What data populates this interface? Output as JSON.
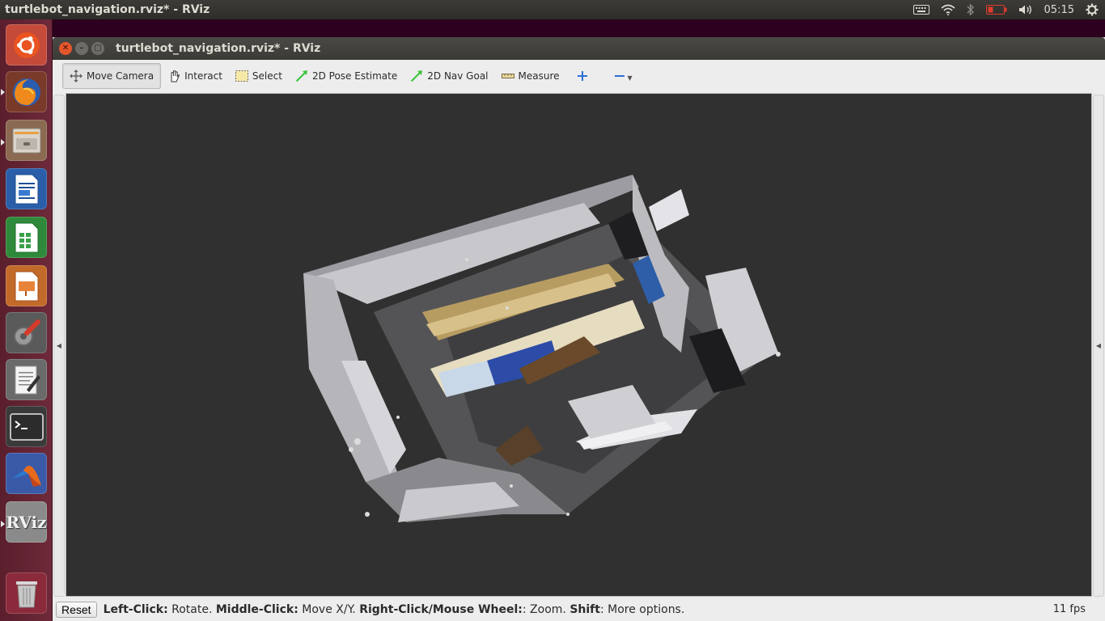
{
  "top_panel": {
    "app_title": "turtlebot_navigation.rviz* - RViz",
    "clock": "05:15",
    "indicators": [
      "keyboard-icon",
      "wifi-icon",
      "bluetooth-icon",
      "battery-icon",
      "volume-icon",
      "settings-gear-icon"
    ]
  },
  "launcher": {
    "items": [
      "ubuntu-dash",
      "firefox",
      "files",
      "libreoffice-writer",
      "libreoffice-calc",
      "libreoffice-impress",
      "system-settings",
      "text-editor",
      "terminal",
      "matlab",
      "rviz",
      "trash"
    ],
    "rviz_label": "RViz"
  },
  "window": {
    "title": "turtlebot_navigation.rviz* - RViz",
    "colors": {
      "viewport_bg": "#303030",
      "accent_green": "#3cc43c",
      "accent_blue": "#2a6fd6"
    }
  },
  "toolbar": {
    "tools": [
      {
        "label": "Move Camera",
        "icon": "move-camera-icon",
        "active": true
      },
      {
        "label": "Interact",
        "icon": "hand-icon",
        "active": false
      },
      {
        "label": "Select",
        "icon": "select-rect-icon",
        "active": false
      },
      {
        "label": "2D Pose Estimate",
        "icon": "green-arrow-icon",
        "active": false
      },
      {
        "label": "2D Nav Goal",
        "icon": "green-arrow-icon",
        "active": false
      },
      {
        "label": "Measure",
        "icon": "ruler-icon",
        "active": false
      }
    ],
    "add_tool_icon": "plus-icon",
    "remove_tool_icon": "minus-icon"
  },
  "status": {
    "reset_label": "Reset",
    "hint_parts": [
      {
        "bold": "Left-Click:",
        "text": " Rotate. "
      },
      {
        "bold": "Middle-Click:",
        "text": " Move X/Y. "
      },
      {
        "bold": "Right-Click/Mouse Wheel:",
        "text": ": Zoom. "
      },
      {
        "bold": "Shift",
        "text": ": More options."
      }
    ],
    "fps": "11 fps"
  }
}
